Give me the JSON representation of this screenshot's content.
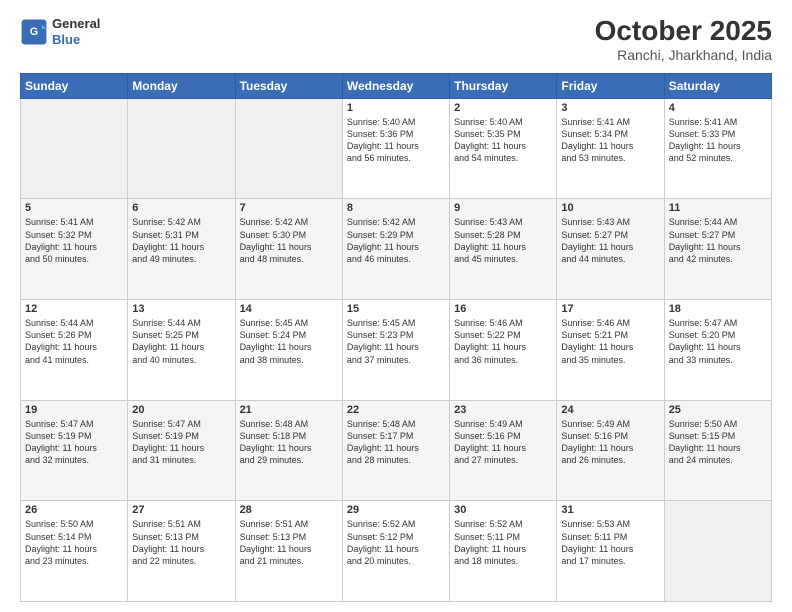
{
  "header": {
    "logo_line1": "General",
    "logo_line2": "Blue",
    "month_title": "October 2025",
    "subtitle": "Ranchi, Jharkhand, India"
  },
  "weekdays": [
    "Sunday",
    "Monday",
    "Tuesday",
    "Wednesday",
    "Thursday",
    "Friday",
    "Saturday"
  ],
  "weeks": [
    [
      {
        "num": "",
        "text": ""
      },
      {
        "num": "",
        "text": ""
      },
      {
        "num": "",
        "text": ""
      },
      {
        "num": "1",
        "text": "Sunrise: 5:40 AM\nSunset: 5:36 PM\nDaylight: 11 hours\nand 56 minutes."
      },
      {
        "num": "2",
        "text": "Sunrise: 5:40 AM\nSunset: 5:35 PM\nDaylight: 11 hours\nand 54 minutes."
      },
      {
        "num": "3",
        "text": "Sunrise: 5:41 AM\nSunset: 5:34 PM\nDaylight: 11 hours\nand 53 minutes."
      },
      {
        "num": "4",
        "text": "Sunrise: 5:41 AM\nSunset: 5:33 PM\nDaylight: 11 hours\nand 52 minutes."
      }
    ],
    [
      {
        "num": "5",
        "text": "Sunrise: 5:41 AM\nSunset: 5:32 PM\nDaylight: 11 hours\nand 50 minutes."
      },
      {
        "num": "6",
        "text": "Sunrise: 5:42 AM\nSunset: 5:31 PM\nDaylight: 11 hours\nand 49 minutes."
      },
      {
        "num": "7",
        "text": "Sunrise: 5:42 AM\nSunset: 5:30 PM\nDaylight: 11 hours\nand 48 minutes."
      },
      {
        "num": "8",
        "text": "Sunrise: 5:42 AM\nSunset: 5:29 PM\nDaylight: 11 hours\nand 46 minutes."
      },
      {
        "num": "9",
        "text": "Sunrise: 5:43 AM\nSunset: 5:28 PM\nDaylight: 11 hours\nand 45 minutes."
      },
      {
        "num": "10",
        "text": "Sunrise: 5:43 AM\nSunset: 5:27 PM\nDaylight: 11 hours\nand 44 minutes."
      },
      {
        "num": "11",
        "text": "Sunrise: 5:44 AM\nSunset: 5:27 PM\nDaylight: 11 hours\nand 42 minutes."
      }
    ],
    [
      {
        "num": "12",
        "text": "Sunrise: 5:44 AM\nSunset: 5:26 PM\nDaylight: 11 hours\nand 41 minutes."
      },
      {
        "num": "13",
        "text": "Sunrise: 5:44 AM\nSunset: 5:25 PM\nDaylight: 11 hours\nand 40 minutes."
      },
      {
        "num": "14",
        "text": "Sunrise: 5:45 AM\nSunset: 5:24 PM\nDaylight: 11 hours\nand 38 minutes."
      },
      {
        "num": "15",
        "text": "Sunrise: 5:45 AM\nSunset: 5:23 PM\nDaylight: 11 hours\nand 37 minutes."
      },
      {
        "num": "16",
        "text": "Sunrise: 5:46 AM\nSunset: 5:22 PM\nDaylight: 11 hours\nand 36 minutes."
      },
      {
        "num": "17",
        "text": "Sunrise: 5:46 AM\nSunset: 5:21 PM\nDaylight: 11 hours\nand 35 minutes."
      },
      {
        "num": "18",
        "text": "Sunrise: 5:47 AM\nSunset: 5:20 PM\nDaylight: 11 hours\nand 33 minutes."
      }
    ],
    [
      {
        "num": "19",
        "text": "Sunrise: 5:47 AM\nSunset: 5:19 PM\nDaylight: 11 hours\nand 32 minutes."
      },
      {
        "num": "20",
        "text": "Sunrise: 5:47 AM\nSunset: 5:19 PM\nDaylight: 11 hours\nand 31 minutes."
      },
      {
        "num": "21",
        "text": "Sunrise: 5:48 AM\nSunset: 5:18 PM\nDaylight: 11 hours\nand 29 minutes."
      },
      {
        "num": "22",
        "text": "Sunrise: 5:48 AM\nSunset: 5:17 PM\nDaylight: 11 hours\nand 28 minutes."
      },
      {
        "num": "23",
        "text": "Sunrise: 5:49 AM\nSunset: 5:16 PM\nDaylight: 11 hours\nand 27 minutes."
      },
      {
        "num": "24",
        "text": "Sunrise: 5:49 AM\nSunset: 5:16 PM\nDaylight: 11 hours\nand 26 minutes."
      },
      {
        "num": "25",
        "text": "Sunrise: 5:50 AM\nSunset: 5:15 PM\nDaylight: 11 hours\nand 24 minutes."
      }
    ],
    [
      {
        "num": "26",
        "text": "Sunrise: 5:50 AM\nSunset: 5:14 PM\nDaylight: 11 hours\nand 23 minutes."
      },
      {
        "num": "27",
        "text": "Sunrise: 5:51 AM\nSunset: 5:13 PM\nDaylight: 11 hours\nand 22 minutes."
      },
      {
        "num": "28",
        "text": "Sunrise: 5:51 AM\nSunset: 5:13 PM\nDaylight: 11 hours\nand 21 minutes."
      },
      {
        "num": "29",
        "text": "Sunrise: 5:52 AM\nSunset: 5:12 PM\nDaylight: 11 hours\nand 20 minutes."
      },
      {
        "num": "30",
        "text": "Sunrise: 5:52 AM\nSunset: 5:11 PM\nDaylight: 11 hours\nand 18 minutes."
      },
      {
        "num": "31",
        "text": "Sunrise: 5:53 AM\nSunset: 5:11 PM\nDaylight: 11 hours\nand 17 minutes."
      },
      {
        "num": "",
        "text": ""
      }
    ]
  ]
}
